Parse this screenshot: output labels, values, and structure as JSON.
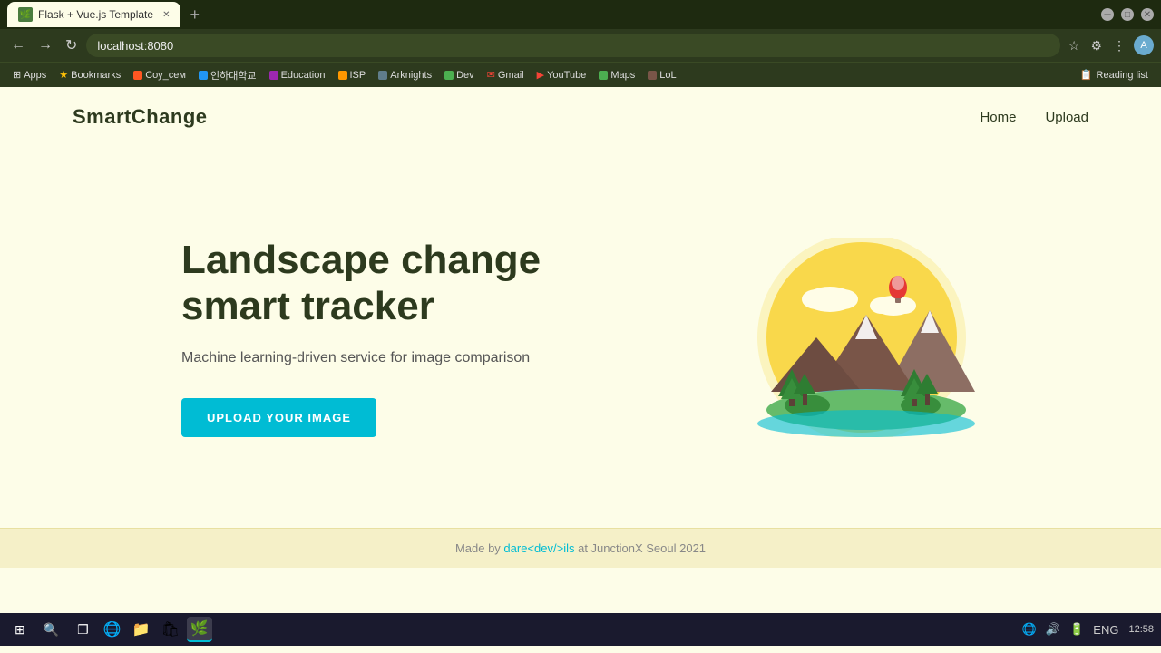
{
  "browser": {
    "tab_title": "Flask + Vue.js Template",
    "tab_favicon": "🌿",
    "address": "localhost:8080",
    "new_tab_label": "+",
    "bookmarks": [
      {
        "label": "Apps",
        "color": "#4CAF50"
      },
      {
        "label": "Bookmarks",
        "color": "#FFC107"
      },
      {
        "label": "Соу_сем",
        "color": "#FF5722"
      },
      {
        "label": "인하대학교",
        "color": "#2196F3"
      },
      {
        "label": "Education",
        "color": "#9C27B0"
      },
      {
        "label": "ISP",
        "color": "#FF9800"
      },
      {
        "label": "Arknights",
        "color": "#607D8B"
      },
      {
        "label": "Dev",
        "color": "#4CAF50"
      },
      {
        "label": "Gmail",
        "color": "#F44336"
      },
      {
        "label": "YouTube",
        "color": "#F44336"
      },
      {
        "label": "Maps",
        "color": "#4CAF50"
      },
      {
        "label": "LoL",
        "color": "#795548"
      }
    ],
    "reading_list": "Reading list"
  },
  "site": {
    "logo": "SmartChange",
    "nav": {
      "home": "Home",
      "upload": "Upload"
    },
    "hero": {
      "title_line1": "Landscape change",
      "title_line2": "smart tracker",
      "subtitle": "Machine learning-driven service for image comparison",
      "cta_button": "UPLOAD YOUR IMAGE"
    },
    "footer": {
      "prefix": "Made by ",
      "author": "dare<dev/>ils",
      "suffix": " at JunctionX Seoul 2021"
    }
  },
  "taskbar": {
    "time": "12:58",
    "date": "",
    "lang": "ENG"
  },
  "colors": {
    "accent_teal": "#00bcd4",
    "dark_green": "#2d3a1e",
    "bg_cream": "#fdfde8"
  }
}
